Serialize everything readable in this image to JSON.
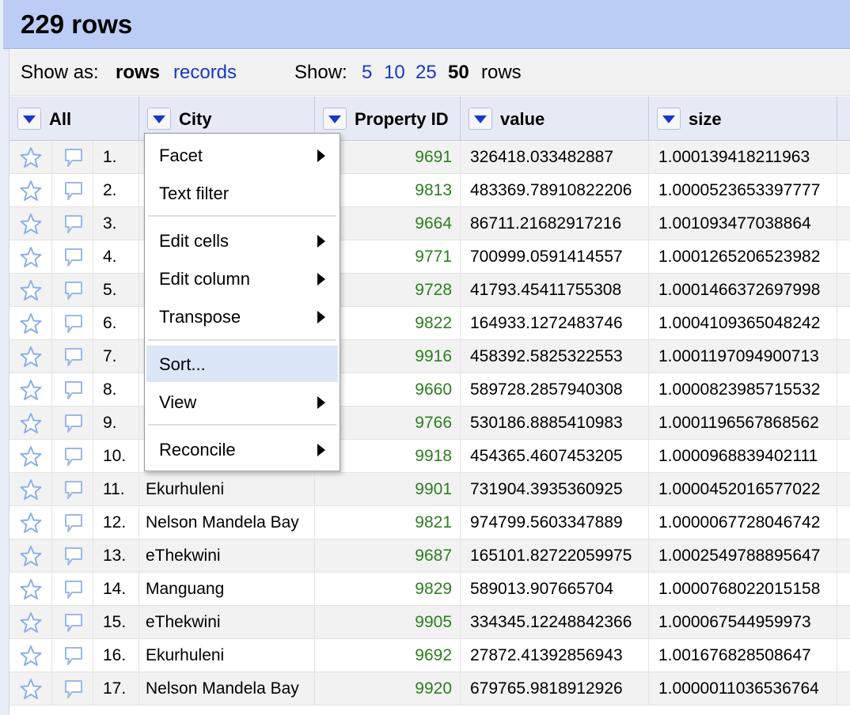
{
  "header": {
    "title": "229 rows"
  },
  "viewbar": {
    "show_as_label": "Show as:",
    "rows_label": "rows",
    "records_label": "records",
    "show_label": "Show:",
    "page_sizes": [
      "5",
      "10",
      "25",
      "50"
    ],
    "selected_page_size": "50",
    "rows_suffix": "rows"
  },
  "columns": {
    "all": "All",
    "city": "City",
    "property_id": "Property ID",
    "value": "value",
    "size": "size"
  },
  "menu": {
    "facet": "Facet",
    "text_filter": "Text filter",
    "edit_cells": "Edit cells",
    "edit_column": "Edit column",
    "transpose": "Transpose",
    "sort": "Sort...",
    "view": "View",
    "reconcile": "Reconcile"
  },
  "rows": [
    {
      "idx": "1.",
      "city": "",
      "pid": "9691",
      "value": "326418.033482887",
      "size": "1.000139418211963"
    },
    {
      "idx": "2.",
      "city": "",
      "pid": "9813",
      "value": "483369.78910822206",
      "size": "1.0000523653397777"
    },
    {
      "idx": "3.",
      "city": "",
      "pid": "9664",
      "value": "86711.21682917216",
      "size": "1.001093477038864"
    },
    {
      "idx": "4.",
      "city": "",
      "pid": "9771",
      "value": "700999.0591414557",
      "size": "1.0001265206523982"
    },
    {
      "idx": "5.",
      "city": "",
      "pid": "9728",
      "value": "41793.45411755308",
      "size": "1.0001466372697998"
    },
    {
      "idx": "6.",
      "city": "",
      "pid": "9822",
      "value": "164933.1272483746",
      "size": "1.0004109365048242"
    },
    {
      "idx": "7.",
      "city": "",
      "pid": "9916",
      "value": "458392.5825322553",
      "size": "1.0001197094900713"
    },
    {
      "idx": "8.",
      "city": "",
      "pid": "9660",
      "value": "589728.2857940308",
      "size": "1.0000823985715532"
    },
    {
      "idx": "9.",
      "city": "",
      "pid": "9766",
      "value": "530186.8885410983",
      "size": "1.0001196567868562"
    },
    {
      "idx": "10.",
      "city": "",
      "pid": "9918",
      "value": "454365.4607453205",
      "size": "1.0000968839402111"
    },
    {
      "idx": "11.",
      "city": "Ekurhuleni",
      "pid": "9901",
      "value": "731904.3935360925",
      "size": "1.0000452016577022"
    },
    {
      "idx": "12.",
      "city": "Nelson Mandela Bay",
      "pid": "9821",
      "value": "974799.5603347889",
      "size": "1.0000067728046742"
    },
    {
      "idx": "13.",
      "city": "eThekwini",
      "pid": "9687",
      "value": "165101.82722059975",
      "size": "1.0002549788895647"
    },
    {
      "idx": "14.",
      "city": "Manguang",
      "pid": "9829",
      "value": "589013.907665704",
      "size": "1.0000768022015158"
    },
    {
      "idx": "15.",
      "city": "eThekwini",
      "pid": "9905",
      "value": "334345.12248842366",
      "size": "1.000067544959973"
    },
    {
      "idx": "16.",
      "city": "Ekurhuleni",
      "pid": "9692",
      "value": "27872.41392856943",
      "size": "1.00167682850864​7"
    },
    {
      "idx": "17.",
      "city": "Nelson Mandela Bay",
      "pid": "9920",
      "value": "679765.9818912926",
      "size": "1.0000011036536764"
    }
  ]
}
